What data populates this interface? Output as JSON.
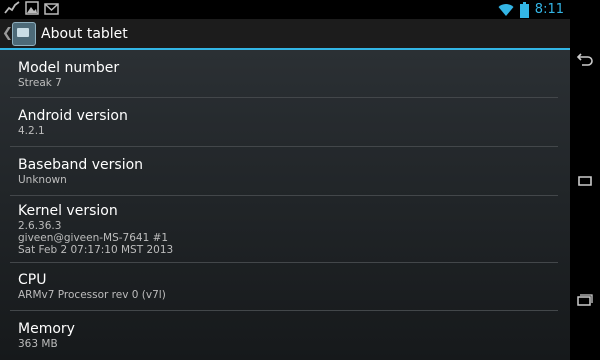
{
  "status_bar": {
    "left_icons": [
      "activity-graph-icon",
      "gallery-icon",
      "gmail-icon"
    ],
    "right_icons": [
      "wifi-icon",
      "battery-icon"
    ],
    "time": "8:11",
    "accent": "#33b5e5"
  },
  "action_bar": {
    "title": "About tablet",
    "icon": "settings-app-icon"
  },
  "items": [
    {
      "title": "Model number",
      "lines": [
        "Streak 7"
      ]
    },
    {
      "title": "Android version",
      "lines": [
        "4.2.1"
      ]
    },
    {
      "title": "Baseband version",
      "lines": [
        "Unknown"
      ]
    },
    {
      "title": "Kernel version",
      "lines": [
        "2.6.36.3",
        "giveen@giveen-MS-7641 #1",
        "Sat Feb 2 07:17:10 MST 2013"
      ]
    },
    {
      "title": "CPU",
      "lines": [
        "ARMv7 Processor rev 0 (v7l)"
      ]
    },
    {
      "title": "Memory",
      "lines": [
        "363 MB"
      ]
    }
  ],
  "nav_bar": {
    "buttons": [
      "back-icon",
      "home-icon",
      "recent-apps-icon"
    ]
  }
}
